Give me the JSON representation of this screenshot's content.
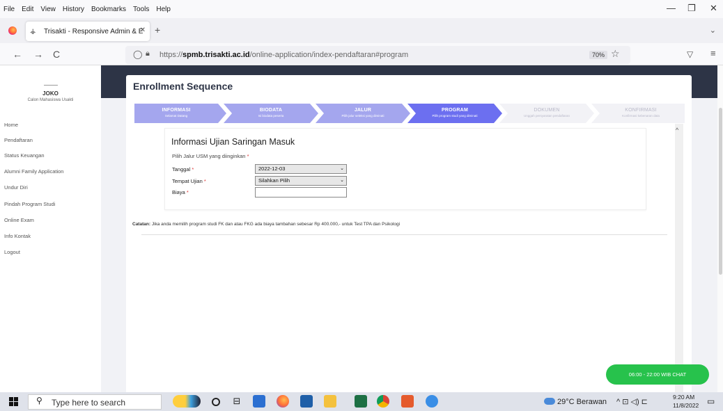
{
  "menu": {
    "items": [
      "File",
      "Edit",
      "View",
      "History",
      "Bookmarks",
      "Tools",
      "Help"
    ]
  },
  "window_controls": {
    "minimize": "—",
    "restore": "❐",
    "close": "✕"
  },
  "tab": {
    "title": "Trisakti - Responsive Admin & E",
    "close": "✕",
    "new_tab": "+",
    "list": "⌄"
  },
  "nav": {
    "back": "←",
    "forward": "→",
    "reload": "C",
    "url_host": "spmb.trisakti.ac.id",
    "url_prefix": "https://",
    "url_path": "/online-application/index-pendaftaran#program",
    "zoom": "70%"
  },
  "sidebar": {
    "user_name": "JOKO",
    "user_role": "Calon Mahasiswa Usakti",
    "items": [
      "Home",
      "Pendaftaran",
      "Status Keuangan",
      "Alumni Family Application",
      "Undur Diri",
      "Pindah Program Studi",
      "Online Exam",
      "Info Kontak",
      "Logout"
    ]
  },
  "main": {
    "title": "Enrollment Sequence",
    "steps": [
      {
        "title": "INFORMASI",
        "sub": "Selamat Datang",
        "state": "done"
      },
      {
        "title": "BIODATA",
        "sub": "Isi biodata peserta",
        "state": "done"
      },
      {
        "title": "JALUR",
        "sub": "Pilih jalur seleksi yang diminati",
        "state": "done"
      },
      {
        "title": "PROGRAM",
        "sub": "Pilih program studi yang diminati",
        "state": "active"
      },
      {
        "title": "DOKUMEN",
        "sub": "Unggah persyaratan pendaftaran",
        "state": "todo"
      },
      {
        "title": "KONFIRMASI",
        "sub": "Konfirmasi kebenaran data",
        "state": "todo"
      }
    ],
    "panel_title": "Informasi Ujian Saringan Masuk",
    "jalur_label": "Pilih Jalur USM yang diinginkan",
    "req_mark": "*",
    "fields": {
      "tanggal_label": "Tanggal",
      "tanggal_value": "2022-12-03",
      "tempat_label": "Tempat Ujian",
      "tempat_value": "Silahkan Pilih",
      "biaya_label": "Biaya",
      "biaya_value": ""
    },
    "note_label": "Catatan:",
    "note_text": " Jika anda memilih program studi FK dan atau FKG ada biaya tambahan sebesar Rp 400.000,- untuk Test TPA dan Psikologi",
    "chat_label": "06:00 - 22:00 WIB CHAT"
  },
  "taskbar": {
    "search_placeholder": "Type here to search",
    "weather": "29°C  Berawan",
    "tray": "^  ⊡  ◁)  ⊏",
    "time": "9:20 AM",
    "date": "11/8/2022",
    "notif": "▭"
  },
  "colors": {
    "step_done": "#a4a6ee",
    "step_active": "#6c6ff0",
    "step_todo": "#f2f2f6",
    "header_band": "#2d3446",
    "chat": "#27c24c"
  }
}
